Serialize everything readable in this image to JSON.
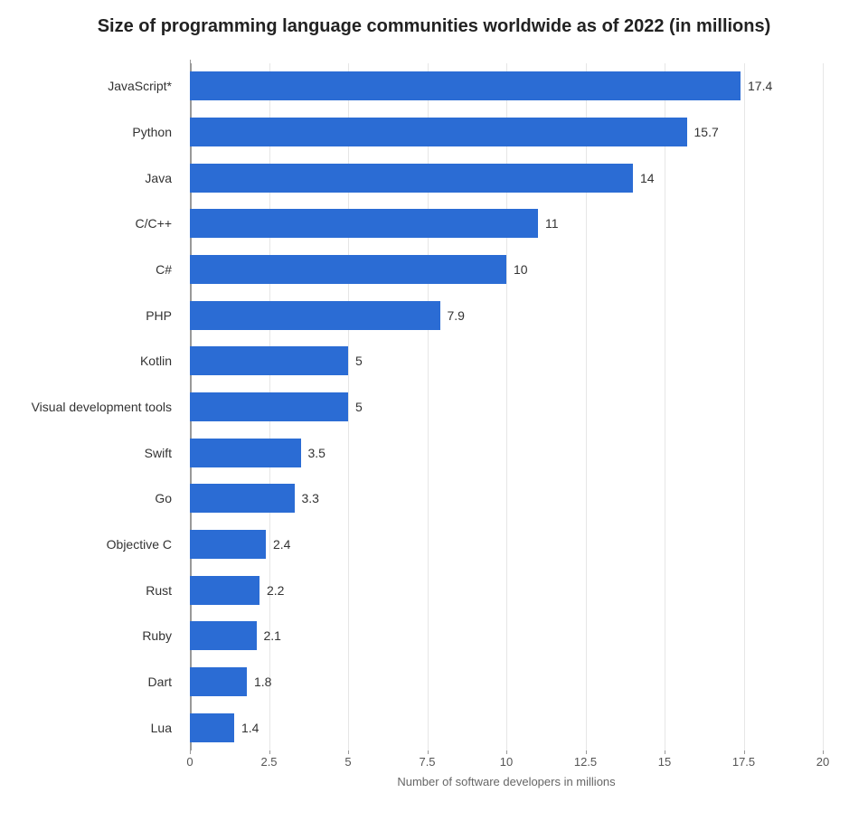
{
  "chart_data": {
    "type": "bar",
    "title": "Size of programming language communities worldwide as of 2022 (in millions)",
    "xlabel": "Number of software developers in millions",
    "ylabel": "",
    "categories": [
      "JavaScript*",
      "Python",
      "Java",
      "C/C++",
      "C#",
      "PHP",
      "Kotlin",
      "Visual development tools",
      "Swift",
      "Go",
      "Objective C",
      "Rust",
      "Ruby",
      "Dart",
      "Lua"
    ],
    "values": [
      17.4,
      15.7,
      14,
      11,
      10,
      7.9,
      5,
      5,
      3.5,
      3.3,
      2.4,
      2.2,
      2.1,
      1.8,
      1.4
    ],
    "xlim": [
      0,
      20
    ],
    "x_ticks": [
      0,
      2.5,
      5,
      7.5,
      10,
      12.5,
      15,
      17.5,
      20
    ],
    "bar_color": "#2b6cd4"
  }
}
